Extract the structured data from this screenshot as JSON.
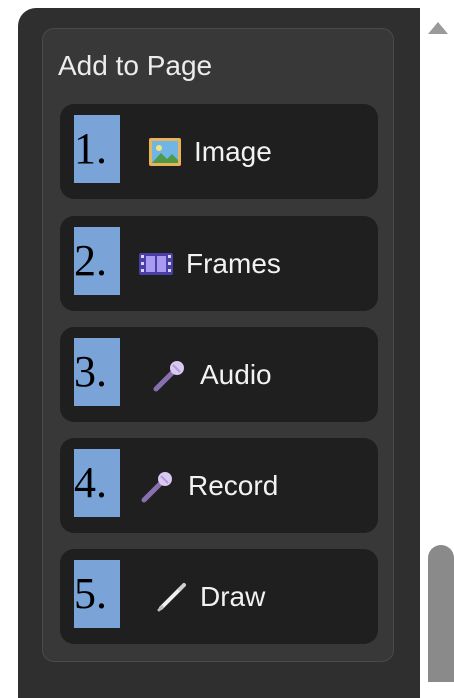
{
  "panel": {
    "title": "Add to Page"
  },
  "buttons": [
    {
      "number": "1.",
      "label": "Image",
      "icon": "image-icon"
    },
    {
      "number": "2.",
      "label": "Frames",
      "icon": "film-frames-icon"
    },
    {
      "number": "3.",
      "label": "Audio",
      "icon": "microphone-icon"
    },
    {
      "number": "4.",
      "label": "Record",
      "icon": "microphone-icon"
    },
    {
      "number": "5.",
      "label": "Draw",
      "icon": "pen-icon"
    }
  ],
  "colors": {
    "panel_bg": "#383838",
    "outer_bg": "#2f2f2f",
    "button_bg": "#1f1f1f",
    "number_highlight": "#7aa3d8",
    "text": "#f2f2f2"
  }
}
